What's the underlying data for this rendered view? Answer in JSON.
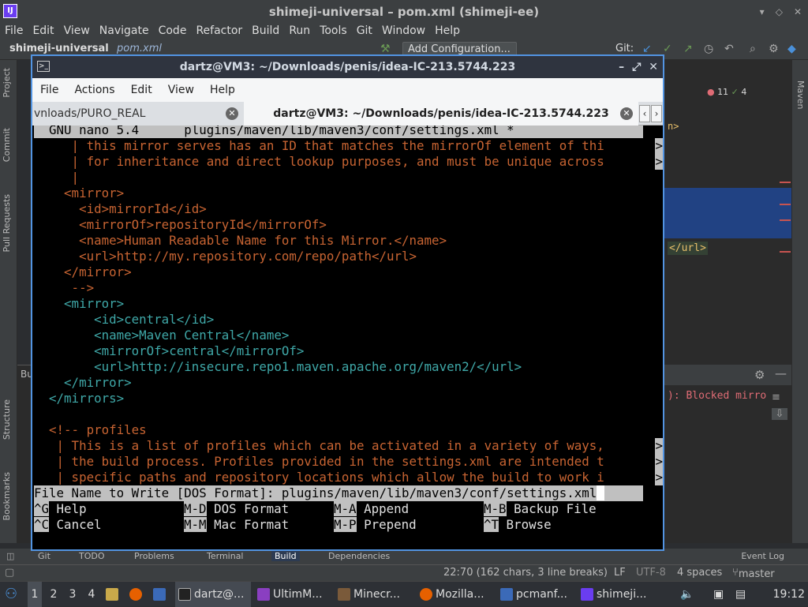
{
  "ide": {
    "title": "shimeji-universal – pom.xml (shimeji-ee)",
    "logo": "IJ",
    "menu": [
      "File",
      "Edit",
      "View",
      "Navigate",
      "Code",
      "Refactor",
      "Build",
      "Run",
      "Tools",
      "Git",
      "Window",
      "Help"
    ],
    "project": "shimeji-universal",
    "file_crumb": "pom.xml",
    "add_config": "Add Configuration...",
    "git_label": "Git:",
    "left_tools": [
      "Project",
      "Commit",
      "Pull Requests",
      "Structure",
      "Bookmarks"
    ],
    "right_tools": [
      "Maven"
    ],
    "error_count": "11",
    "ok_count": "4",
    "url_tag": "</url>",
    "n_tag": "n>",
    "build_short": "Bu",
    "blocked_text": "): Blocked mirro",
    "tool_tabs": [
      "Git",
      "TODO",
      "Problems",
      "Terminal",
      "Build",
      "Dependencies"
    ],
    "event_log": "Event Log",
    "status": {
      "position": "22:70 (162 chars, 3 line breaks)",
      "line_sep": "LF",
      "encoding": "UTF-8",
      "indent": "4 spaces",
      "branch": "master"
    }
  },
  "terminal": {
    "title": "dartz@VM3: ~/Downloads/penis/idea-IC-213.5744.223",
    "menu": [
      "File",
      "Actions",
      "Edit",
      "View",
      "Help"
    ],
    "tabs": [
      {
        "label": "vnloads/PURO_REAL"
      },
      {
        "label": "dartz@VM3: ~/Downloads/penis/idea-IC-213.5744.223"
      }
    ],
    "nano_header": "  GNU nano 5.4      plugins/maven/lib/maven3/conf/settings.xml *",
    "lines": [
      "     | this mirror serves has an ID that matches the mirrorOf element of thi",
      "     | for inheritance and direct lookup purposes, and must be unique across",
      "     |",
      "    <mirror>",
      "      <id>mirrorId</id>",
      "      <mirrorOf>repositoryId</mirrorOf>",
      "      <name>Human Readable Name for this Mirror.</name>",
      "      <url>http://my.repository.com/repo/path</url>",
      "    </mirror>",
      "     -->",
      "    <mirror>",
      "        <id>central</id>",
      "        <name>Maven Central</name>",
      "        <mirrorOf>central</mirrorOf>",
      "        <url>http://insecure.repo1.maven.apache.org/maven2/</url>",
      "    </mirror>",
      "  </mirrors>",
      "",
      "  <!-- profiles",
      "   | This is a list of profiles which can be activated in a variety of ways,",
      "   | the build process. Profiles provided in the settings.xml are intended t",
      "   | specific paths and repository locations which allow the build to work i"
    ],
    "prompt": "File Name to Write [DOS Format]: plugins/maven/lib/maven3/conf/settings.xml",
    "shortcuts_row1": [
      {
        "key": "^G",
        "label": "Help"
      },
      {
        "key": "M-D",
        "label": "DOS Format"
      },
      {
        "key": "M-A",
        "label": "Append"
      },
      {
        "key": "M-B",
        "label": "Backup File"
      }
    ],
    "shortcuts_row2": [
      {
        "key": "^C",
        "label": "Cancel"
      },
      {
        "key": "M-M",
        "label": "Mac Format"
      },
      {
        "key": "M-P",
        "label": "Prepend"
      },
      {
        "key": "^T",
        "label": "Browse"
      }
    ]
  },
  "taskbar": {
    "workspaces": [
      "1",
      "2",
      "3",
      "4"
    ],
    "items": [
      "dartz@...",
      "UltimM...",
      "Minecr...",
      "Mozilla...",
      "pcmanf...",
      "shimeji..."
    ],
    "clock": "19:12"
  }
}
